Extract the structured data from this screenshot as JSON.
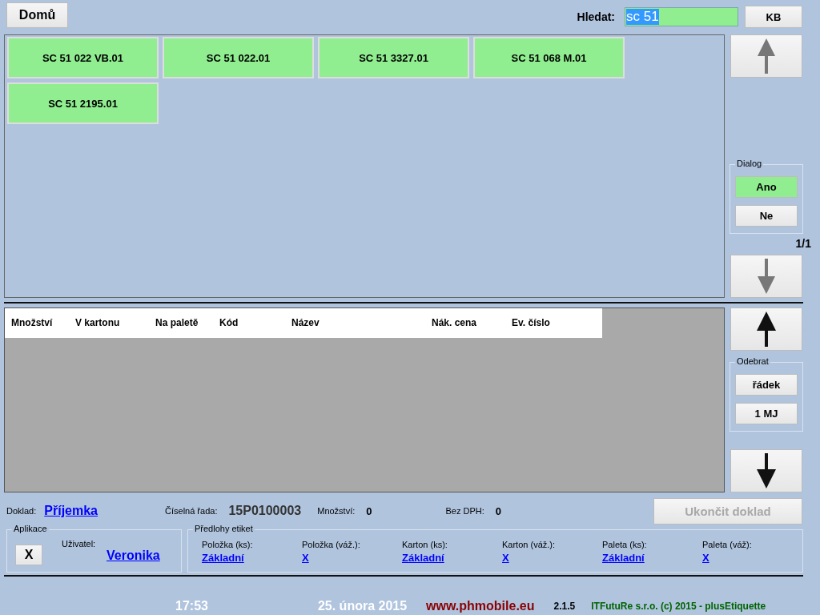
{
  "home_button": "Domů",
  "search": {
    "label": "Hledat:",
    "value": "sc 51",
    "value_selected": true
  },
  "keyboard_button": "KB",
  "results": [
    {
      "label": "SC 51 022 VB.01"
    },
    {
      "label": "SC 51 022.01"
    },
    {
      "label": "SC 51 3327.01"
    },
    {
      "label": "SC 51 068 M.01"
    },
    {
      "label": "SC 51 2195.01"
    }
  ],
  "dialog": {
    "title": "Dialog",
    "options": [
      {
        "label": "Ano",
        "selected": true
      },
      {
        "label": "Ne",
        "selected": false
      }
    ]
  },
  "page_indicator": "1/1",
  "table": {
    "columns": [
      "Množství",
      "V kartonu",
      "Na paletě",
      "Kód",
      "Název",
      "Nák. cena",
      "Ev. číslo"
    ]
  },
  "remove": {
    "title": "Odebrat",
    "buttons": [
      "řádek",
      "1 MJ"
    ]
  },
  "document": {
    "label": "Doklad:",
    "value": "Příjemka",
    "series_label": "Číselná řada:",
    "series_value": "15P0100003",
    "quantity_label": "Množství:",
    "quantity_value": "0",
    "net_label": "Bez DPH:",
    "net_value": "0"
  },
  "finish_button": {
    "label": "Ukončit doklad",
    "disabled": true
  },
  "application": {
    "title": "Aplikace",
    "close_button": "X",
    "user_label": "Uživatel:",
    "user": "Veronika"
  },
  "label_templates": {
    "title": "Předlohy etiket",
    "items": [
      {
        "label": "Položka (ks):",
        "value": "Základní"
      },
      {
        "label": "Položka (váž.):",
        "value": "X"
      },
      {
        "label": "Karton (ks):",
        "value": "Základní"
      },
      {
        "label": "Karton (váž.):",
        "value": "X"
      },
      {
        "label": "Paleta (ks):",
        "value": "Základní"
      },
      {
        "label": "Paleta (váž):",
        "value": "X"
      }
    ]
  },
  "footer": {
    "time": "17:53",
    "date": "25. února 2015",
    "website": "www.phmobile.eu",
    "version": "2.1.5",
    "copyright": "ITFutuRe s.r.o. (c) 2015 - plusEtiquette"
  }
}
